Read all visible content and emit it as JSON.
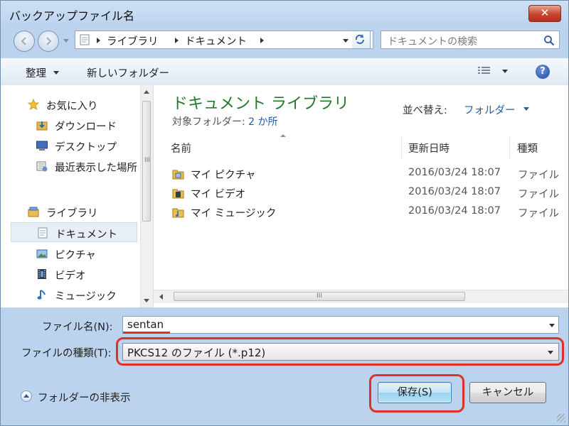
{
  "window": {
    "title": "バックアップファイル名",
    "close_label": "✕"
  },
  "address": {
    "crumbs": [
      "ライブラリ",
      "ドキュメント"
    ],
    "search_placeholder": "ドキュメントの検索"
  },
  "toolbar": {
    "organize_label": "整理",
    "new_folder_label": "新しいフォルダー",
    "help_label": "?"
  },
  "nav": {
    "items": [
      {
        "label": "お気に入り",
        "icon": "star-icon"
      },
      {
        "label": "ダウンロード",
        "icon": "download-folder-icon"
      },
      {
        "label": "デスクトップ",
        "icon": "desktop-icon"
      },
      {
        "label": "最近表示した場所",
        "icon": "recent-places-icon"
      },
      {
        "label": "ライブラリ",
        "icon": "library-icon"
      },
      {
        "label": "ドキュメント",
        "icon": "document-icon"
      },
      {
        "label": "ピクチャ",
        "icon": "pictures-icon"
      },
      {
        "label": "ビデオ",
        "icon": "video-icon"
      },
      {
        "label": "ミュージック",
        "icon": "music-icon"
      }
    ]
  },
  "content": {
    "library_title": "ドキュメント ライブラリ",
    "target_label": "対象フォルダー:",
    "target_link": "2 か所",
    "sort_label": "並べ替え:",
    "sort_value": "フォルダー",
    "columns": {
      "name": "名前",
      "date": "更新日時",
      "type": "種類"
    },
    "scroll_grip": "III",
    "files": [
      {
        "name": "マイ ピクチャ",
        "date": "2016/03/24 18:07",
        "type": "ファイル"
      },
      {
        "name": "マイ ビデオ",
        "date": "2016/03/24 18:07",
        "type": "ファイル"
      },
      {
        "name": "マイ ミュージック",
        "date": "2016/03/24 18:07",
        "type": "ファイル"
      }
    ]
  },
  "form": {
    "filename_label": "ファイル名(N):",
    "filename_value": "sentan",
    "filetype_label": "ファイルの種類(T):",
    "filetype_value": "PKCS12 のファイル (*.p12)"
  },
  "footer": {
    "hide_folders_label": "フォルダーの非表示",
    "save_label": "保存(S)",
    "cancel_label": "キャンセル"
  },
  "colors": {
    "highlight": "#e0302a",
    "library_title": "#1f7a2a",
    "link": "#1a5fb4"
  }
}
